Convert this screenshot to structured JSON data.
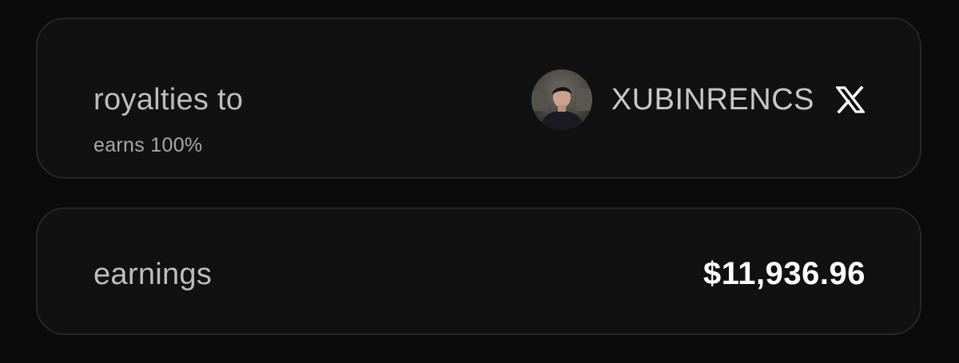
{
  "royalties": {
    "title": "royalties to",
    "subtitle": "earns 100%",
    "creator_name": "XUBINRENCS",
    "avatar_icon": "user-avatar-photo",
    "social_icon": "x-logo-icon"
  },
  "earnings": {
    "label": "earnings",
    "value": "$11,936.96"
  },
  "colors": {
    "background": "#0b0b0c",
    "card": "#111112",
    "card_border": "#262628",
    "primary_text": "#ffffff",
    "secondary_text": "#bdbdbd"
  }
}
